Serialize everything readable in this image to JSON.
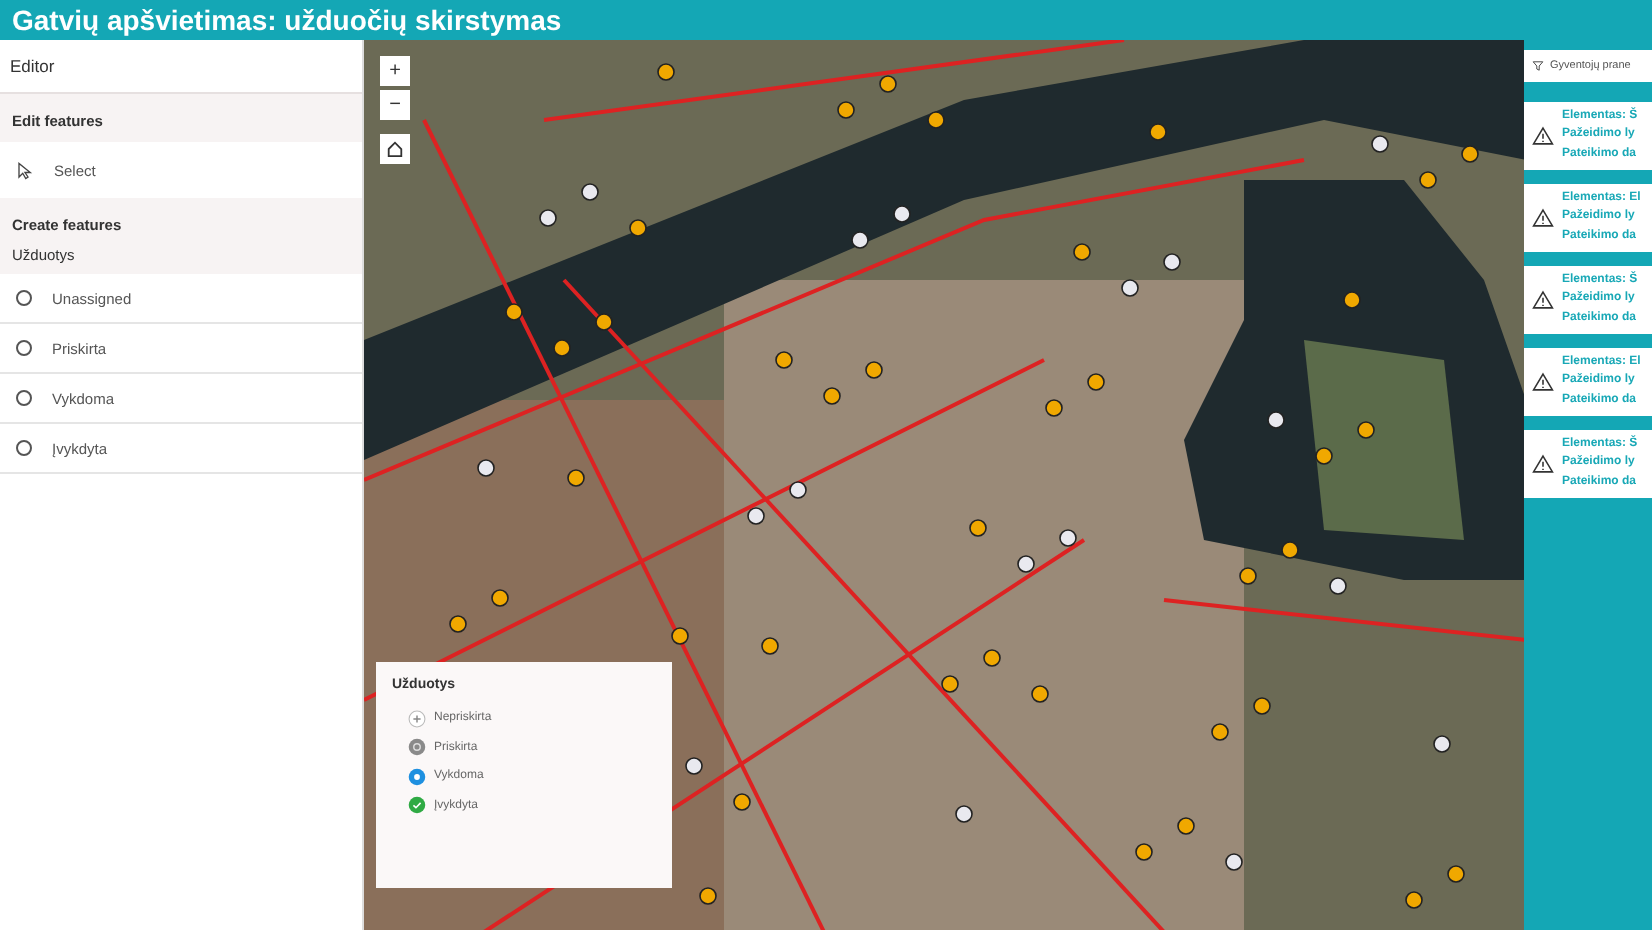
{
  "header": {
    "title": "Gatvių apšvietimas: užduočių skirstymas"
  },
  "editor": {
    "title": "Editor",
    "edit_section": "Edit features",
    "tools": [
      {
        "label": "Select",
        "kind": "select"
      }
    ],
    "create_section": "Create features",
    "layer": "Užduotys",
    "templates": [
      {
        "label": "Unassigned",
        "selected": false
      },
      {
        "label": "Priskirta",
        "selected": false
      },
      {
        "label": "Vykdoma",
        "selected": false
      },
      {
        "label": "Įvykdyta",
        "selected": false
      }
    ]
  },
  "map_controls": [
    {
      "kind": "zoom-in",
      "label": "+"
    },
    {
      "kind": "zoom-out",
      "label": "−"
    },
    {
      "kind": "home"
    }
  ],
  "legend": {
    "title": "Užduotys",
    "items": [
      {
        "label": "Nepriskirta",
        "kind": "unassigned"
      },
      {
        "label": "Priskirta",
        "kind": "assigned"
      },
      {
        "label": "Vykdoma",
        "kind": "in-progress"
      },
      {
        "label": "Įvykdyta",
        "kind": "done"
      }
    ]
  },
  "reports": {
    "filter": "Gyventojų prane",
    "cards": [
      {
        "element": "Elementas: Š",
        "level": "Pažeidimo ly",
        "date": "Pateikimo da"
      },
      {
        "element": "Elementas: El",
        "level": "Pažeidimo ly",
        "date": "Pateikimo da"
      },
      {
        "element": "Elementas: Š",
        "level": "Pažeidimo ly",
        "date": "Pateikimo da"
      },
      {
        "element": "Elementas: El",
        "level": "Pažeidimo ly",
        "date": "Pateikimo da"
      },
      {
        "element": "Elementas: Š",
        "level": "Pažeidimo ly",
        "date": "Pateikimo da"
      }
    ]
  }
}
